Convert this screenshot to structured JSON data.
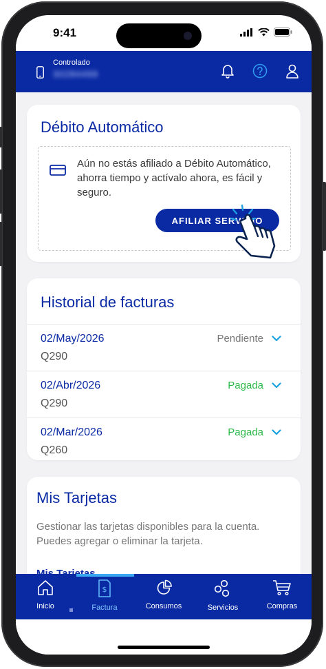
{
  "status_bar": {
    "time": "9:41"
  },
  "app_bar": {
    "controlled_label": "Controlado",
    "number": "30284499"
  },
  "debito": {
    "title": "Débito Automático",
    "text": "Aún no estás afiliado a Débito Automático, ahorra tiempo y actívalo ahora, es fácil y seguro.",
    "button_label": "AFILIAR SERVICIO"
  },
  "historial": {
    "title": "Historial de facturas",
    "items": [
      {
        "date": "02/May/2026",
        "amount": "Q290",
        "status": "Pendiente"
      },
      {
        "date": "02/Abr/2026",
        "amount": "Q290",
        "status": "Pagada"
      },
      {
        "date": "02/Mar/2026",
        "amount": "Q260",
        "status": "Pagada"
      }
    ]
  },
  "tarjetas": {
    "title": "Mis Tarjetas",
    "description": "Gestionar las tarjetas disponibles para la cuenta. Puedes agregar o eliminar la tarjeta.",
    "subtitle": "Mis Tarjetas"
  },
  "tabs": [
    {
      "label": "Inicio",
      "icon": "home-icon"
    },
    {
      "label": "Factura",
      "icon": "invoice-icon",
      "active": true
    },
    {
      "label": "Consumos",
      "icon": "pie-chart-icon"
    },
    {
      "label": "Servicios",
      "icon": "services-icon"
    },
    {
      "label": "Compras",
      "icon": "cart-icon"
    }
  ],
  "colors": {
    "primary": "#0a2aa4",
    "pending": "#777777",
    "paid": "#2cb84a",
    "chevron": "#1aa3e0",
    "tab_indicator": "#3aa8f0"
  }
}
